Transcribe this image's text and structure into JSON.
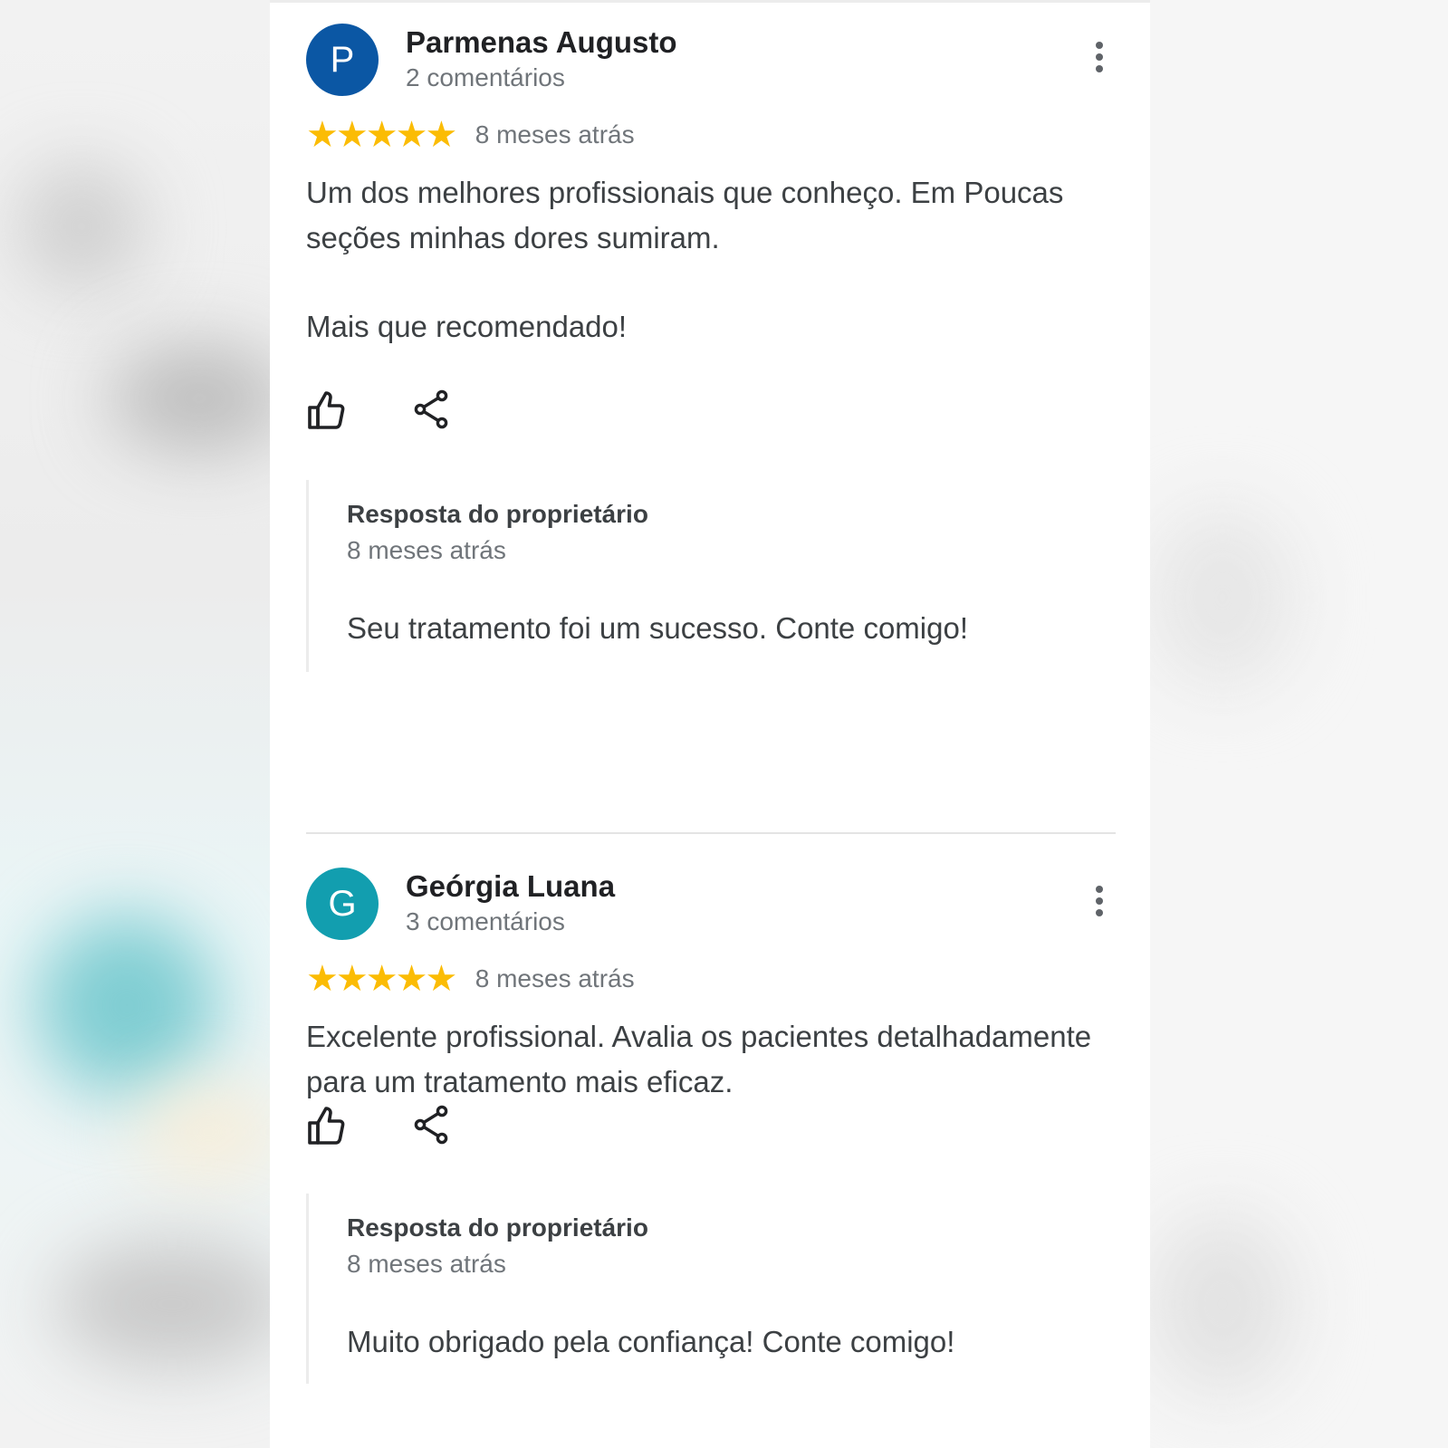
{
  "colors": {
    "star": "#fbbc04",
    "avatar_p": "#0b57a4",
    "avatar_g": "#129eaf",
    "primary_text": "#202124",
    "secondary_text": "#70757a"
  },
  "reviews": [
    {
      "avatar_letter": "P",
      "avatar_color": "#0b57a4",
      "author": "Parmenas Augusto",
      "review_count": "2 comentários",
      "rating": 5,
      "time": "8 meses atrás",
      "paragraphs": [
        "Um dos melhores profissionais que conheço. Em Poucas seções minhas dores sumiram.",
        "Mais que recomendado!"
      ],
      "owner_reply": {
        "title": "Resposta do proprietário",
        "time": "8 meses atrás",
        "text": "Seu tratamento foi um sucesso. Conte comigo!"
      },
      "icons": {
        "like": "thumb-up-icon",
        "share": "share-icon",
        "more": "more-vert-icon"
      }
    },
    {
      "avatar_letter": "G",
      "avatar_color": "#129eaf",
      "author": "Geórgia Luana",
      "review_count": "3 comentários",
      "rating": 5,
      "time": "8 meses atrás",
      "paragraphs": [
        "Excelente profissional. Avalia os pacientes detalhadamente para um tratamento mais eficaz."
      ],
      "owner_reply": {
        "title": "Resposta do proprietário",
        "time": "8 meses atrás",
        "text": "Muito obrigado pela confiança! Conte comigo!"
      },
      "icons": {
        "like": "thumb-up-icon",
        "share": "share-icon",
        "more": "more-vert-icon"
      }
    }
  ]
}
